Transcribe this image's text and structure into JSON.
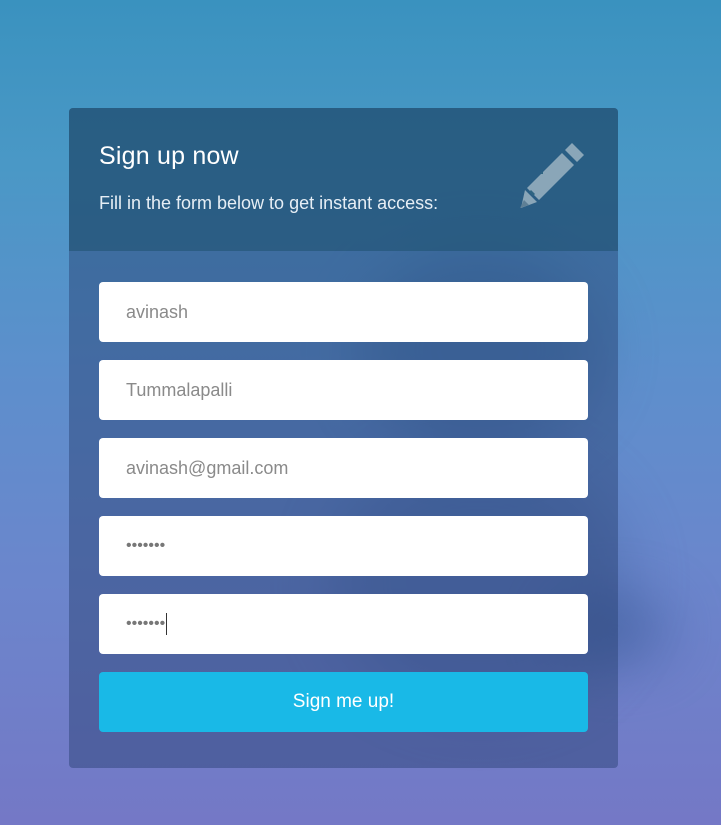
{
  "form": {
    "title": "Sign up now",
    "subtitle": "Fill in the form below to get instant access:",
    "icon": "pencil-icon",
    "first_name": "avinash",
    "last_name": "Tummalapalli",
    "email": "avinash@gmail.com",
    "password_masked": "•••••••",
    "confirm_password_masked": "•••••••",
    "submit_label": "Sign me up!"
  },
  "colors": {
    "button": "#19b9e7",
    "field_bg": "#ffffff",
    "card_header": "#2f6482"
  }
}
